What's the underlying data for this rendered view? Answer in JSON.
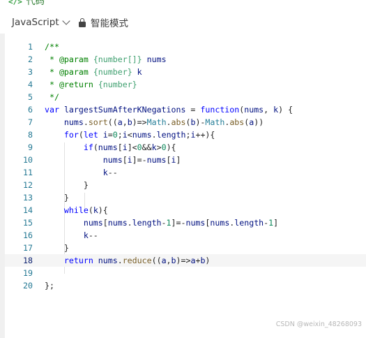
{
  "tab": {
    "icon": "</>",
    "title": "代码"
  },
  "toolbar": {
    "language": "JavaScript",
    "mode": "智能模式"
  },
  "editor": {
    "active_line": 18,
    "lines": [
      "/**",
      " * @param {number[]} nums",
      " * @param {number} k",
      " * @return {number}",
      " */",
      "var largestSumAfterKNegations = function(nums, k) {",
      "    nums.sort((a,b)=>Math.abs(b)-Math.abs(a))",
      "    for(let i=0;i<nums.length;i++){",
      "        if(nums[i]<0&&k>0){",
      "            nums[i]=-nums[i]",
      "            k--",
      "        }",
      "    }",
      "    while(k){",
      "        nums[nums.length-1]=-nums[nums.length-1]",
      "        k--",
      "    }",
      "    return nums.reduce((a,b)=>a+b)",
      "",
      "};"
    ]
  },
  "watermark": "CSDN @weixin_48268093"
}
